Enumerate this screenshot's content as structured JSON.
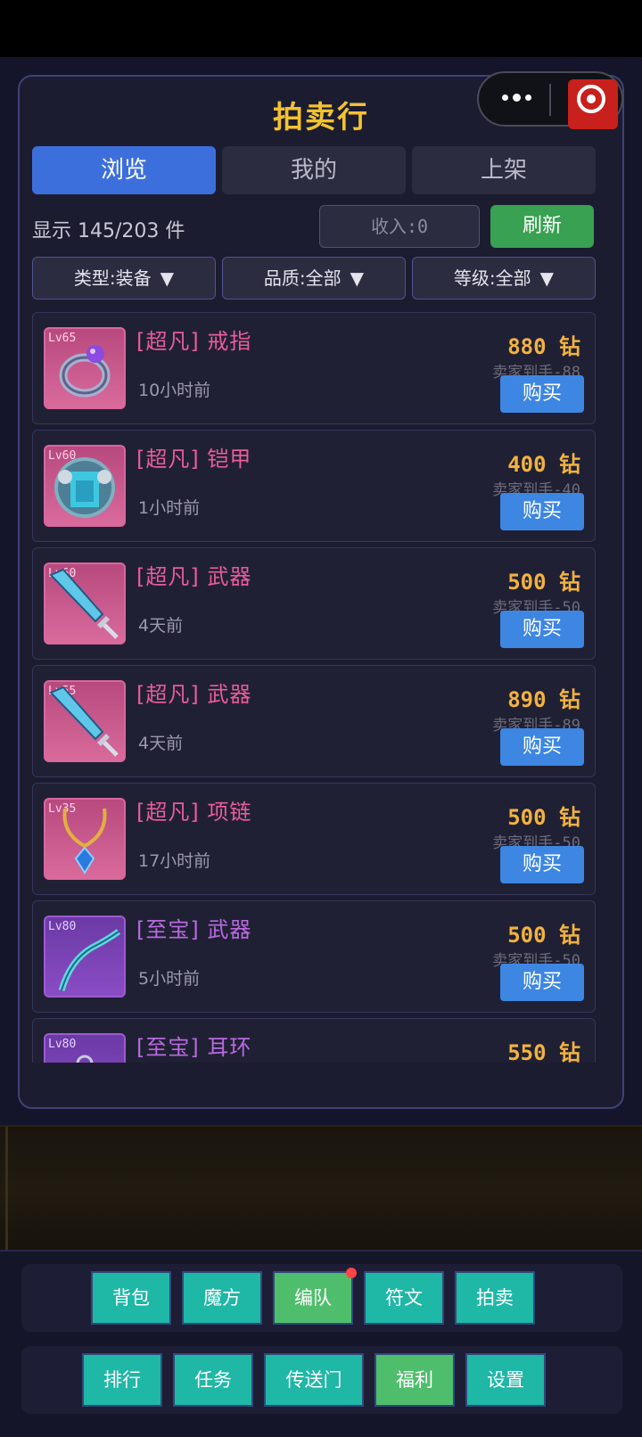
{
  "panel": {
    "title": "拍卖行",
    "tabs": [
      {
        "label": "浏览",
        "active": true
      },
      {
        "label": "我的",
        "active": false
      },
      {
        "label": "上架",
        "active": false
      }
    ],
    "count_text": "显示 145/203 件",
    "income_label": "收入:0",
    "refresh_label": "刷新",
    "filters": [
      {
        "label": "类型:装备",
        "arrow": "▼"
      },
      {
        "label": "品质:全部",
        "arrow": "▼"
      },
      {
        "label": "等级:全部",
        "arrow": "▼"
      }
    ]
  },
  "items": [
    {
      "level": "Lv65",
      "name": "[超凡] 戒指",
      "time": "10小时前",
      "price": "880 钻",
      "net": "卖家到手-88",
      "buy": "购买",
      "icon": "ring-icon",
      "quality": "pink"
    },
    {
      "level": "Lv60",
      "name": "[超凡] 铠甲",
      "time": "1小时前",
      "price": "400 钻",
      "net": "卖家到手-40",
      "buy": "购买",
      "icon": "armor-icon",
      "quality": "pink"
    },
    {
      "level": "Lv60",
      "name": "[超凡] 武器",
      "time": "4天前",
      "price": "500 钻",
      "net": "卖家到手-50",
      "buy": "购买",
      "icon": "sword-icon",
      "quality": "pink"
    },
    {
      "level": "Lv55",
      "name": "[超凡] 武器",
      "time": "4天前",
      "price": "890 钻",
      "net": "卖家到手-89",
      "buy": "购买",
      "icon": "sword-icon",
      "quality": "pink"
    },
    {
      "level": "Lv35",
      "name": "[超凡] 项链",
      "time": "17小时前",
      "price": "500 钻",
      "net": "卖家到手-50",
      "buy": "购买",
      "icon": "necklace-icon",
      "quality": "pink"
    },
    {
      "level": "Lv80",
      "name": "[至宝] 武器",
      "time": "5小时前",
      "price": "500 钻",
      "net": "卖家到手-50",
      "buy": "购买",
      "icon": "bow-icon",
      "quality": "purple"
    },
    {
      "level": "Lv80",
      "name": "[至宝] 耳环",
      "time": "",
      "price": "550 钻",
      "net": "",
      "buy": "",
      "icon": "earring-icon",
      "quality": "purple"
    }
  ],
  "bottom_nav": {
    "row1": [
      {
        "label": "背包"
      },
      {
        "label": "魔方"
      },
      {
        "label": "编队",
        "badge": true
      },
      {
        "label": "符文"
      },
      {
        "label": "拍卖"
      }
    ],
    "row2": [
      {
        "label": "排行"
      },
      {
        "label": "任务"
      },
      {
        "label": "传送门"
      },
      {
        "label": "福利"
      },
      {
        "label": "设置"
      }
    ]
  },
  "colors": {
    "accent_tab": "#3d6fdc",
    "refresh": "#38a152",
    "price": "#f2b240",
    "pink_quality": "#e85c9a",
    "purple_quality": "#b86ae0",
    "buy": "#3d86e2",
    "nav_teal": "#1fb7a6",
    "nav_green": "#4fbe6c"
  }
}
